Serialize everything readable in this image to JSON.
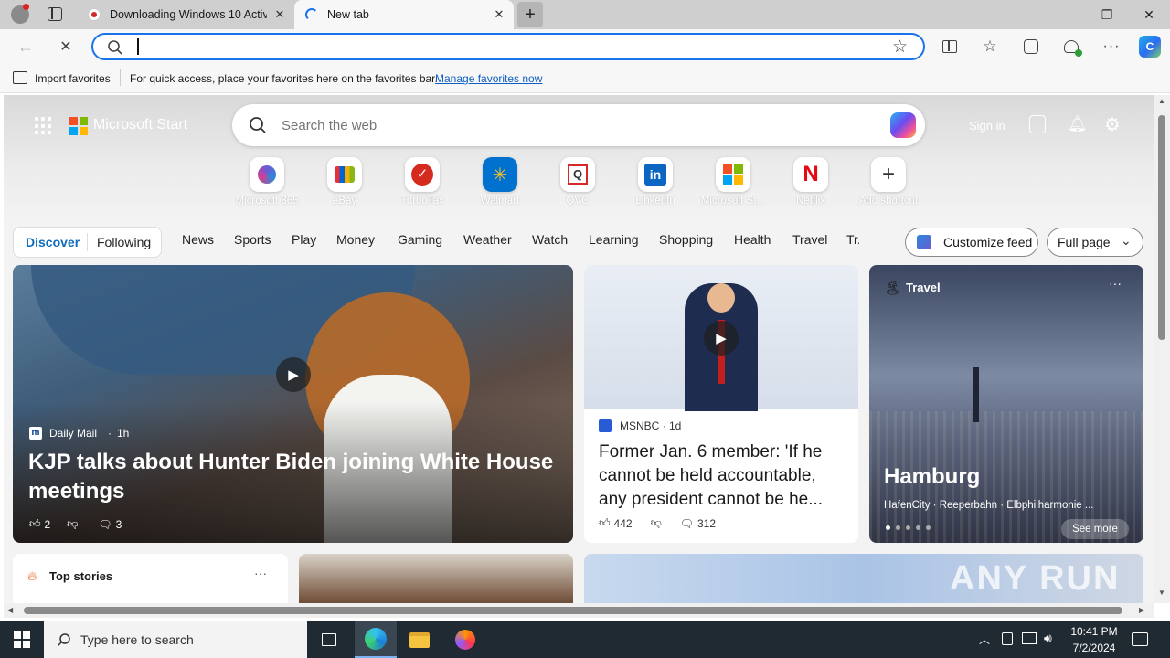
{
  "browser": {
    "tabs": [
      {
        "title": "Downloading Windows 10 Activa",
        "favicon": "red-record-icon"
      },
      {
        "title": "New tab",
        "favicon": "loading-spinner-icon"
      }
    ],
    "address_bar": {
      "value": "",
      "placeholder": ""
    },
    "favorites_bar": {
      "import_label": "Import favorites",
      "hint": "For quick access, place your favorites here on the favorites bar.",
      "manage_link": "Manage favorites now"
    }
  },
  "newtab": {
    "brand": "Microsoft Start",
    "search_placeholder": "Search the web",
    "signin": "Sign in",
    "shortcuts": [
      {
        "label": "Microsoft 365",
        "icon": "m365-icon",
        "color": "#6b5bd6"
      },
      {
        "label": "eBay",
        "icon": "ebay-icon",
        "color": "#333333"
      },
      {
        "label": "TurboTax",
        "icon": "turbotax-icon",
        "color": "#d52b1e"
      },
      {
        "label": "Walmart",
        "icon": "walmart-icon",
        "color": "#0071ce"
      },
      {
        "label": "QVC",
        "icon": "qvc-icon",
        "color": "#333333"
      },
      {
        "label": "LinkedIn",
        "icon": "linkedin-icon",
        "color": "#0a66c2"
      },
      {
        "label": "Microsoft St...",
        "icon": "microsoft-store-icon",
        "color": "#f25022"
      },
      {
        "label": "Netflix",
        "icon": "netflix-icon",
        "color": "#e50914"
      },
      {
        "label": "Add shortcut",
        "icon": "plus-icon",
        "color": "#333333"
      }
    ],
    "feed_tabs": {
      "discover": "Discover",
      "following": "Following"
    },
    "nav": [
      "News",
      "Sports",
      "Play",
      "Money",
      "Gaming",
      "Weather",
      "Watch",
      "Learning",
      "Shopping",
      "Health",
      "Travel",
      "Tr..."
    ],
    "customize_feed": "Customize feed",
    "layout_select": "Full page"
  },
  "cards": {
    "main": {
      "source": "Daily Mail",
      "age": "1h",
      "headline": "KJP talks about Hunter Biden joining White House meetings",
      "likes": "2",
      "comments": "3"
    },
    "msnbc": {
      "source": "MSNBC",
      "age": "1d",
      "headline": "Former Jan. 6 member: 'If he cannot be held accountable, any president cannot be he...",
      "likes": "442",
      "comments": "312"
    },
    "travel": {
      "category": "Travel",
      "city": "Hamburg",
      "tags": "HafenCity · Reeperbahn · Elbphilharmonie ...",
      "see_more": "See more"
    },
    "top_stories": {
      "title": "Top stories"
    }
  },
  "taskbar": {
    "search_placeholder": "Type here to search",
    "time": "10:41 PM",
    "date": "7/2/2024"
  },
  "watermark": "ANY RUN",
  "colors": {
    "accent": "#1a73e8",
    "taskbar": "#1f2a33",
    "discover": "#0f6cbd"
  }
}
